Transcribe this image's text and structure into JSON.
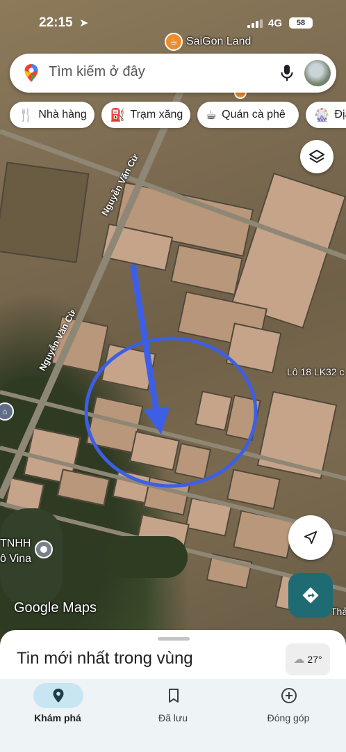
{
  "status_bar": {
    "time": "22:15",
    "network": "4G",
    "battery": "58"
  },
  "map": {
    "place_name": "SaiGon Land",
    "road_name_1": "Nguyễn Văn Cừ",
    "road_name_2": "Nguyễn Văn Cừ",
    "lot_label": "Lô 18 LK32 c",
    "company_line1": "TNHH",
    "company_line2": "ô Vina",
    "edge_label": "Thả",
    "google_logo": "Google Maps"
  },
  "search": {
    "placeholder": "Tìm kiếm ở đây"
  },
  "chips": [
    {
      "label": "Nhà hàng",
      "icon": "restaurant-icon"
    },
    {
      "label": "Trạm xăng",
      "icon": "gas-station-icon"
    },
    {
      "label": "Quán cà phê",
      "icon": "coffee-icon"
    },
    {
      "label": "Địa",
      "icon": "attraction-icon"
    }
  ],
  "sheet": {
    "title": "Tin mới nhất trong vùng",
    "temperature": "27°"
  },
  "nav": [
    {
      "label": "Khám phá",
      "icon": "explore-pin-icon",
      "active": true
    },
    {
      "label": "Đã lưu",
      "icon": "bookmark-icon",
      "active": false
    },
    {
      "label": "Đóng góp",
      "icon": "add-circle-icon",
      "active": false
    }
  ],
  "colors": {
    "annotation_blue": "#3d5fe6",
    "directions_bg": "#1e6b73",
    "active_nav": "#c8e6f2"
  }
}
